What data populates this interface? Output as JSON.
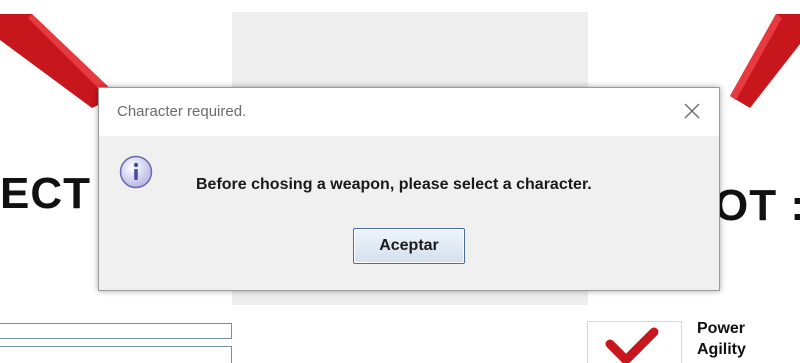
{
  "background": {
    "left_heading": "ECT",
    "right_heading": "OT :",
    "stats": [
      "Power",
      "Agility"
    ],
    "colors": {
      "accent_red": "#c8161d",
      "panel_gray": "#eeeeee"
    }
  },
  "dialog": {
    "title": "Character required.",
    "message": "Before chosing a weapon, please select a character.",
    "accept_label": "Aceptar",
    "icons": {
      "info": "info-icon",
      "close": "close-icon"
    }
  }
}
